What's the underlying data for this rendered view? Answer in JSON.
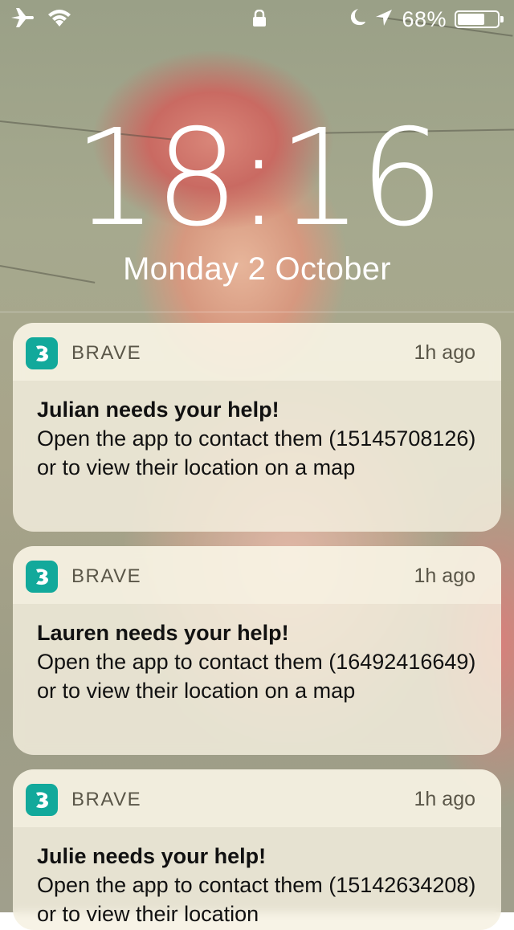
{
  "status_bar": {
    "left_icons": [
      "airplane-icon",
      "wifi-icon"
    ],
    "center_icon": "lock-icon",
    "right_icons": [
      "moon-icon",
      "location-arrow-icon"
    ],
    "battery_percent": "68%",
    "battery_level": 0.68
  },
  "lock_screen": {
    "time": "18:16",
    "date": "Monday 2 October"
  },
  "notifications": [
    {
      "app": "BRAVE",
      "time": "1h ago",
      "title": "Julian needs your help!",
      "message": "Open the app to contact them (15145708126) or to view their location on a map"
    },
    {
      "app": "BRAVE",
      "time": "1h ago",
      "title": "Lauren needs your help!",
      "message": "Open the app to contact them (16492416649) or to view their location on a map"
    },
    {
      "app": "BRAVE",
      "time": "1h ago",
      "title": "Julie needs your help!",
      "message": "Open the app to contact them (15142634208) or to view their location"
    }
  ],
  "colors": {
    "app_icon": "#12a99b",
    "text_secondary": "#5a5648"
  }
}
